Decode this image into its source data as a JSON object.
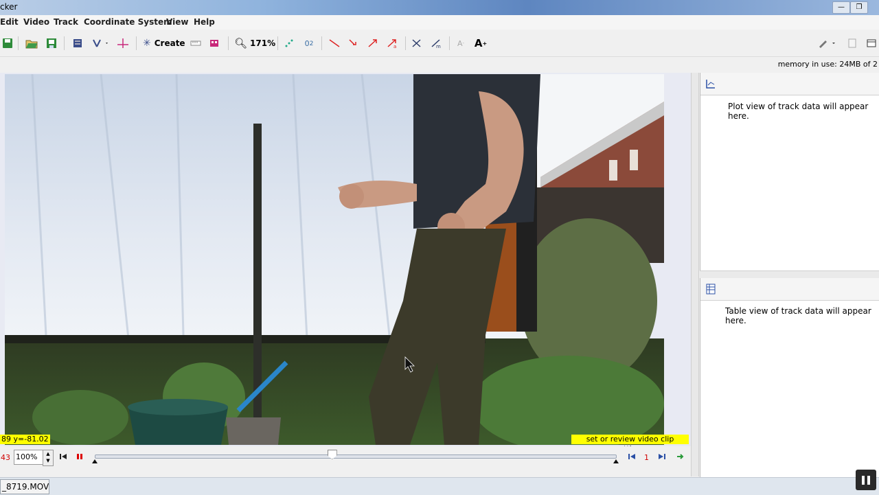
{
  "window": {
    "title": "cker"
  },
  "menu": [
    "Edit",
    "Video",
    "Track",
    "Coordinate System",
    "View",
    "Help"
  ],
  "toolbar": {
    "create_label": "Create",
    "zoom_label": "171%"
  },
  "memory": {
    "text": "memory in use: 24MB of 2"
  },
  "video": {
    "coord_readout": "89  y=-81.02",
    "clip_settings_label": "set or review video clip settings"
  },
  "player": {
    "frame_number": "43",
    "zoom_value": "100%",
    "step_size": "1",
    "slider_fraction": 0.455
  },
  "plot": {
    "message": "Plot view of track data will appear here."
  },
  "table": {
    "message": "Table view of track data will appear here."
  },
  "bottom": {
    "file_tab": "_8719.MOV"
  },
  "colors": {
    "highlight": "#ffff00",
    "frame_red": "#d00000",
    "title_blue": "#5e86c0"
  }
}
